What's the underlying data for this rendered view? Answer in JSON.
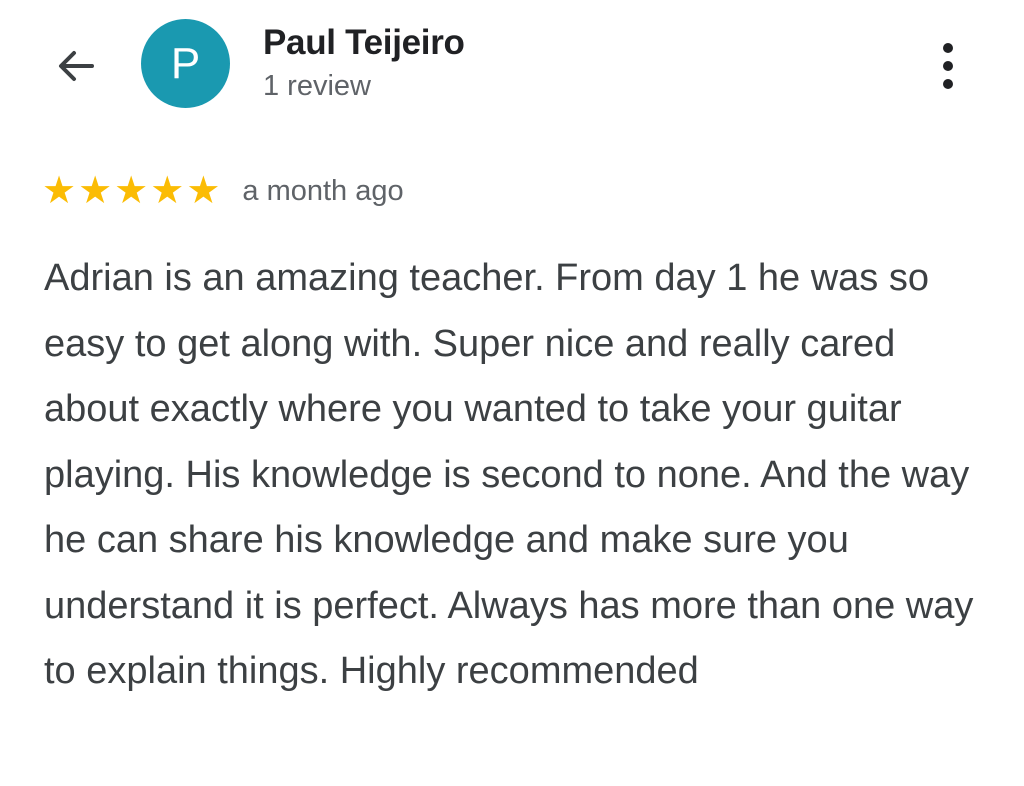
{
  "header": {
    "back_icon": "arrow-back-icon",
    "avatar_letter": "P",
    "avatar_color": "#1a99b0",
    "reviewer_name": "Paul Teijeiro",
    "review_count": "1 review",
    "more_icon": "more-vertical-icon"
  },
  "review": {
    "rating": 5,
    "rating_max": 5,
    "star_color": "#fbbc04",
    "time": "a month ago",
    "text": "Adrian is an amazing teacher. From day 1 he was so easy to get along with. Super nice and really cared about exactly where you wanted to take your guitar playing. His knowledge is second to none. And the way he can share his knowledge and make sure you understand it is perfect. Always has more than one way to explain things. Highly recommended"
  }
}
